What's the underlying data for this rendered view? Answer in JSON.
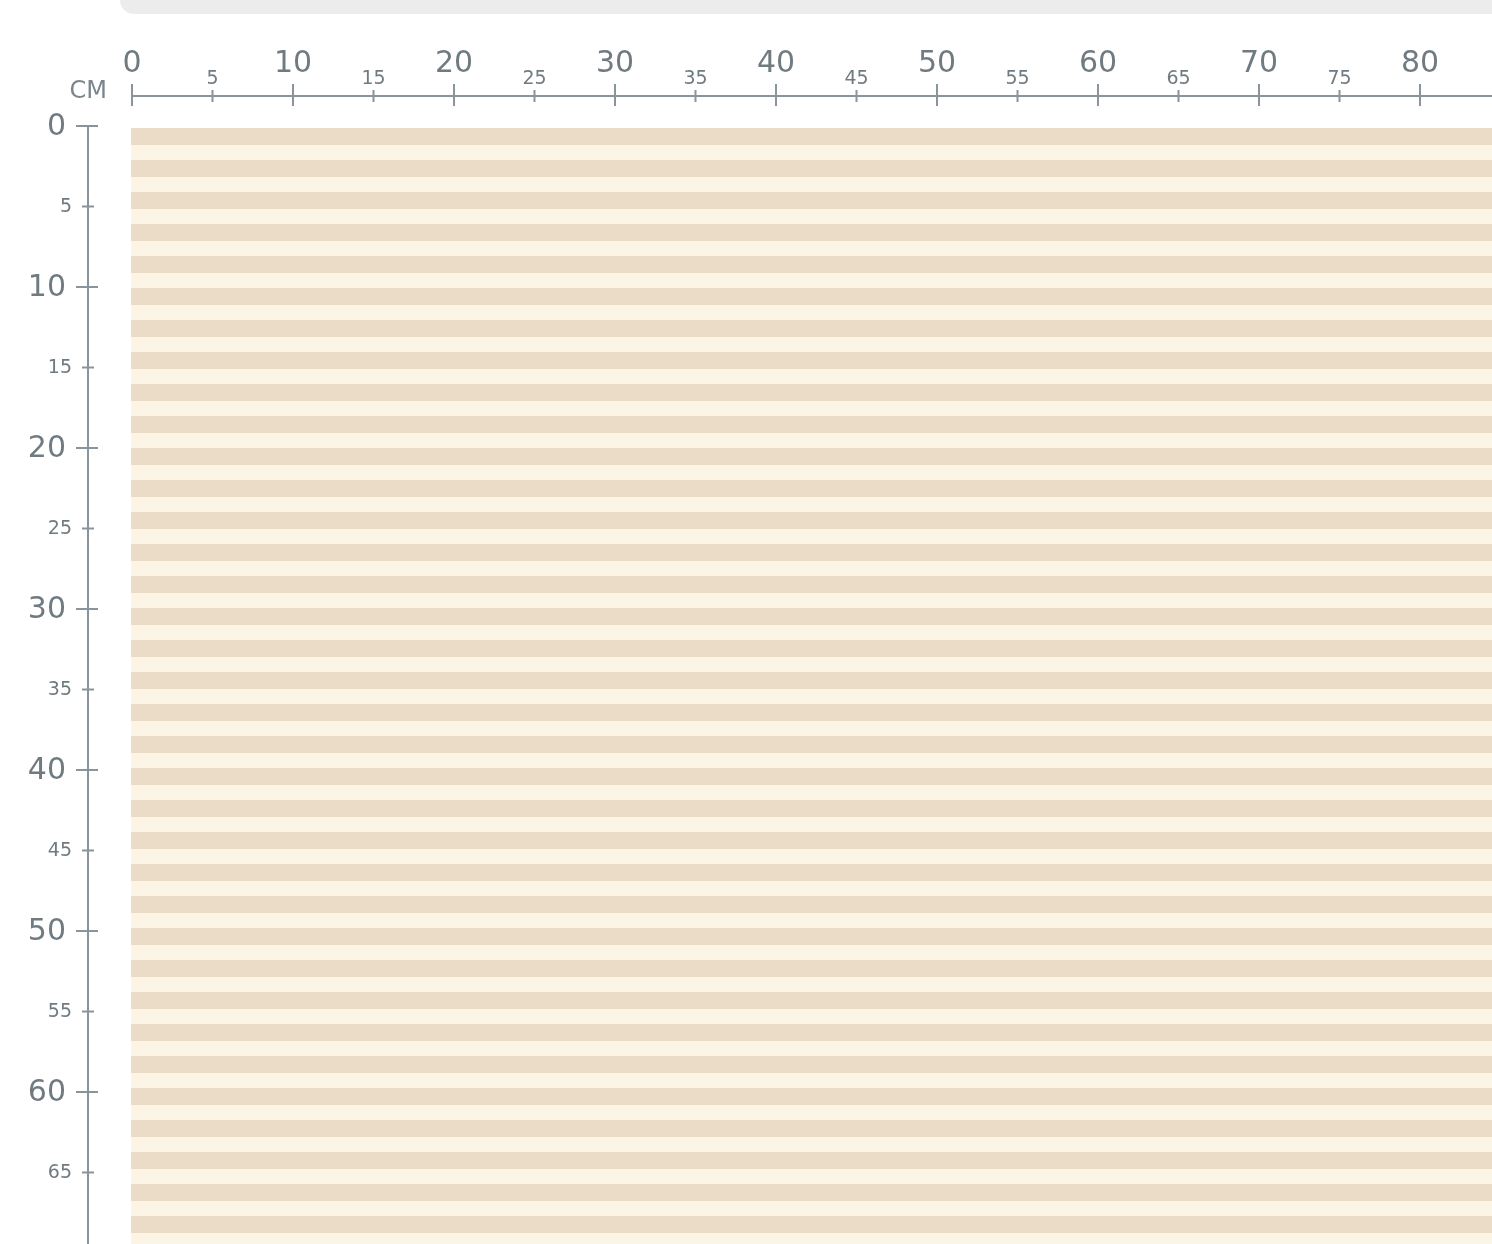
{
  "top_ruler": {
    "unit": "CM",
    "labels": [
      {
        "text": "0",
        "kind": "major"
      },
      {
        "text": "5",
        "kind": "minor"
      },
      {
        "text": "10",
        "kind": "major"
      },
      {
        "text": "15",
        "kind": "minor"
      },
      {
        "text": "20",
        "kind": "major"
      },
      {
        "text": "25",
        "kind": "minor"
      },
      {
        "text": "30",
        "kind": "major"
      },
      {
        "text": "35",
        "kind": "minor"
      },
      {
        "text": "40",
        "kind": "major"
      },
      {
        "text": "45",
        "kind": "minor"
      },
      {
        "text": "50",
        "kind": "major"
      },
      {
        "text": "55",
        "kind": "minor"
      },
      {
        "text": "60",
        "kind": "major"
      },
      {
        "text": "65",
        "kind": "minor"
      },
      {
        "text": "70",
        "kind": "major"
      },
      {
        "text": "75",
        "kind": "minor"
      },
      {
        "text": "80",
        "kind": "major"
      }
    ]
  },
  "side_ruler": {
    "labels": [
      {
        "text": "0",
        "kind": "major"
      },
      {
        "text": "5",
        "kind": "minor"
      },
      {
        "text": "10",
        "kind": "major"
      },
      {
        "text": "15",
        "kind": "minor"
      },
      {
        "text": "20",
        "kind": "major"
      },
      {
        "text": "25",
        "kind": "minor"
      },
      {
        "text": "30",
        "kind": "major"
      },
      {
        "text": "35",
        "kind": "minor"
      },
      {
        "text": "40",
        "kind": "major"
      },
      {
        "text": "45",
        "kind": "minor"
      },
      {
        "text": "50",
        "kind": "major"
      },
      {
        "text": "55",
        "kind": "minor"
      },
      {
        "text": "60",
        "kind": "major"
      },
      {
        "text": "65",
        "kind": "minor"
      }
    ]
  }
}
